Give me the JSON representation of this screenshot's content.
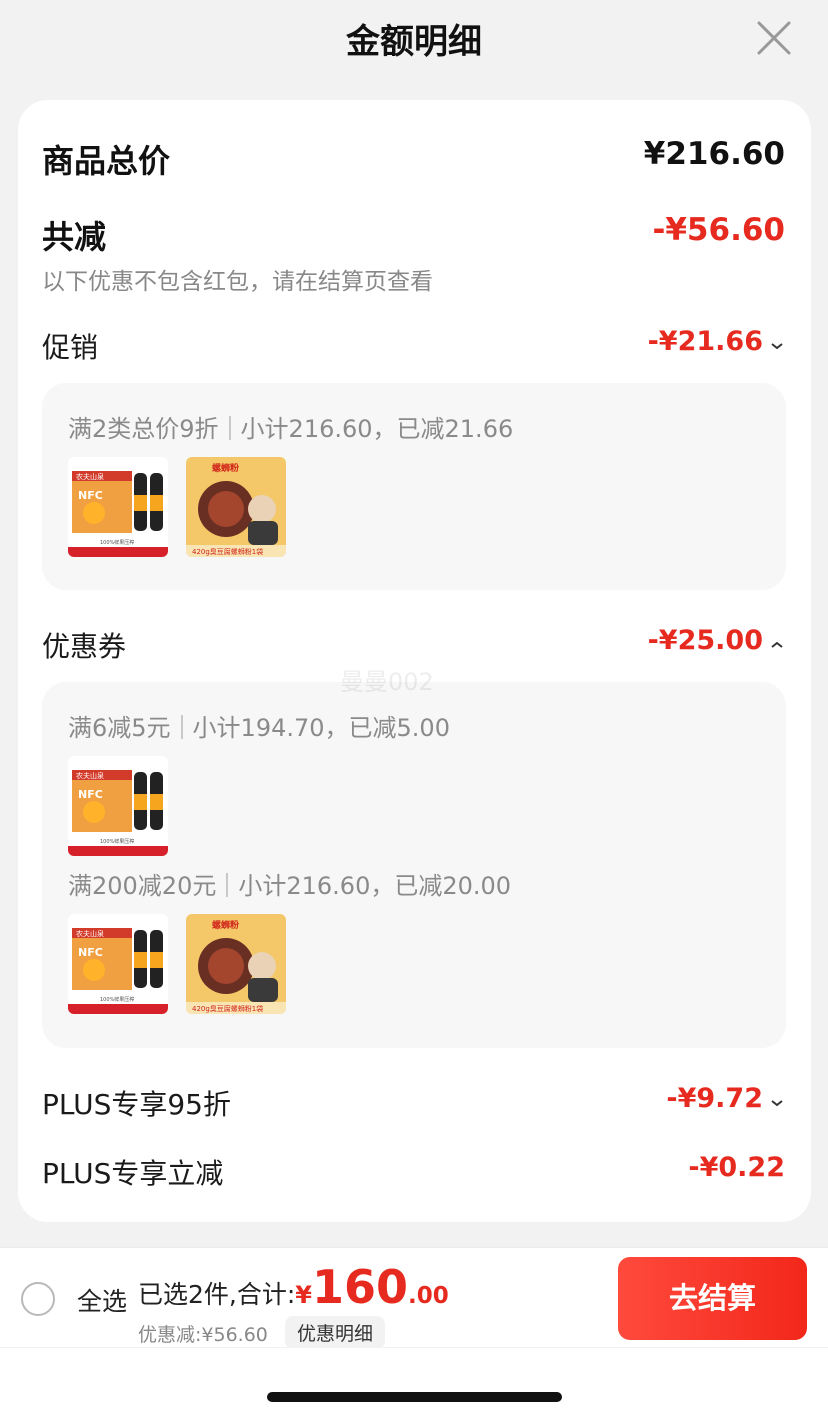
{
  "header": {
    "title": "金额明细"
  },
  "summary": {
    "goods_total_label": "商品总价",
    "goods_total_value": "¥216.60",
    "total_reduce_label": "共减",
    "total_reduce_value": "-¥56.60",
    "note": "以下优惠不包含红包，请在结算页查看"
  },
  "promotion": {
    "label": "促销",
    "value": "-¥21.66",
    "rules": [
      {
        "rule": "满2类总价9折",
        "subtotal": "小计216.60，已减21.66"
      }
    ]
  },
  "coupon": {
    "label": "优惠券",
    "value": "-¥25.00",
    "rules": [
      {
        "rule": "满6减5元",
        "subtotal": "小计194.70，已减5.00"
      },
      {
        "rule": "满200减20元",
        "subtotal": "小计216.60，已减20.00"
      }
    ]
  },
  "products": {
    "juice": {
      "brand": "农夫山泉",
      "badge": "NFC",
      "caption": "100%鲜果压榨",
      "icon": "nfc-orange-juice-box-image"
    },
    "noodles": {
      "headline": "螺蛳粉",
      "caption": "420g臭豆腐螺蛳粉1袋",
      "icon": "snail-noodles-pack-image"
    }
  },
  "plus_95": {
    "label": "PLUS专享95折",
    "value": "-¥9.72"
  },
  "plus_reduce": {
    "label": "PLUS专享立减",
    "value": "-¥0.22"
  },
  "watermark": "曼曼002",
  "bottom": {
    "select_all": "全选",
    "selected_text": "已选2件,合计:",
    "currency": "¥",
    "total_int": "160",
    "total_dec": ".00",
    "discount_text": "优惠减:¥56.60",
    "detail_label": "优惠明细",
    "checkout_label": "去结算"
  },
  "colors": {
    "accent": "#e62a1f",
    "card_bg": "#ffffff",
    "page_bg": "#f2f2f2"
  }
}
